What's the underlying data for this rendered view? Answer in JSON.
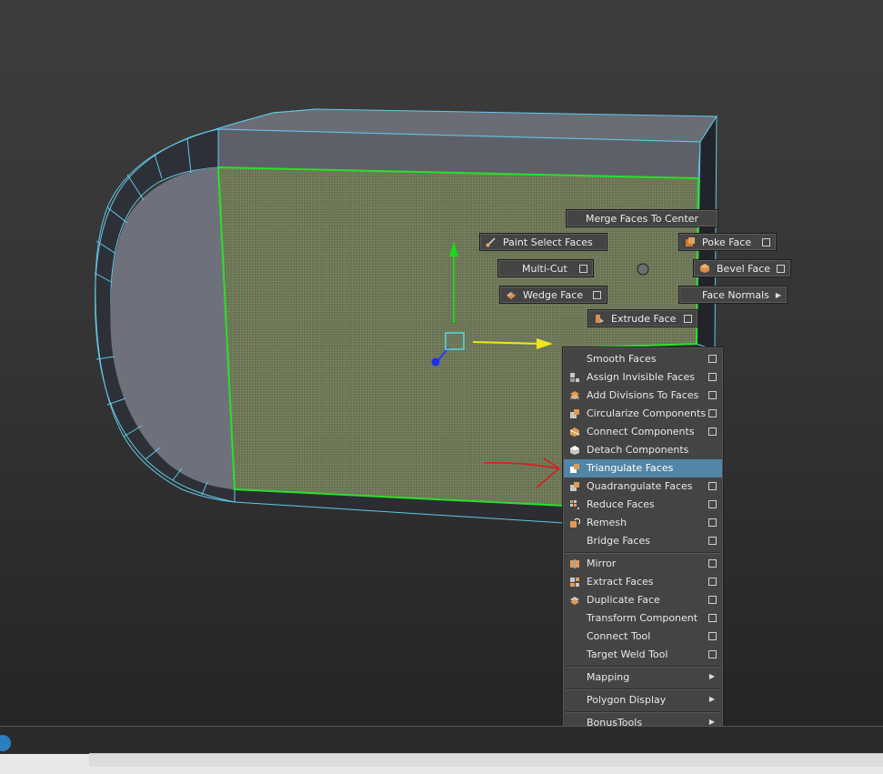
{
  "colors": {
    "wire": "#62c8e6",
    "selection": "#29e129",
    "face_fill": "#6b7556",
    "highlight": "#5285a6",
    "annotation": "#e01818"
  },
  "marking_menu": {
    "merge_faces_to_center": "Merge Faces To Center",
    "paint_select_faces": "Paint Select Faces",
    "poke_face": "Poke Face",
    "multi_cut": "Multi-Cut",
    "bevel_face": "Bevel Face",
    "wedge_face": "Wedge Face",
    "face_normals": "Face Normals",
    "extrude_face": "Extrude Face"
  },
  "menu": {
    "groups": [
      [
        {
          "label": "Smooth Faces",
          "icon": "none",
          "option": true
        },
        {
          "label": "Assign Invisible Faces",
          "icon": "invisible-faces-icon",
          "option": true
        },
        {
          "label": "Add Divisions To Faces",
          "icon": "add-divisions-icon",
          "option": true
        },
        {
          "label": "Circularize Components",
          "icon": "circularize-icon",
          "option": true
        },
        {
          "label": "Connect Components",
          "icon": "connect-components-icon",
          "option": true
        },
        {
          "label": "Detach Components",
          "icon": "detach-icon",
          "option": false
        },
        {
          "label": "Triangulate Faces",
          "icon": "triangulate-icon",
          "option": false,
          "highlighted": true
        },
        {
          "label": "Quadrangulate Faces",
          "icon": "quadrangulate-icon",
          "option": true
        },
        {
          "label": "Reduce Faces",
          "icon": "reduce-icon",
          "option": true
        },
        {
          "label": "Remesh",
          "icon": "remesh-icon",
          "option": true
        },
        {
          "label": "Bridge Faces",
          "icon": "none",
          "option": true
        }
      ],
      [
        {
          "label": "Mirror",
          "icon": "mirror-icon",
          "option": true
        },
        {
          "label": "Extract Faces",
          "icon": "extract-icon",
          "option": true
        },
        {
          "label": "Duplicate Face",
          "icon": "duplicate-icon",
          "option": true
        },
        {
          "label": "Transform Component",
          "icon": "none",
          "option": true
        },
        {
          "label": "Connect Tool",
          "icon": "none",
          "option": true
        },
        {
          "label": "Target Weld Tool",
          "icon": "none",
          "option": true
        }
      ],
      [
        {
          "label": "Mapping",
          "icon": "none",
          "submenu": true
        }
      ],
      [
        {
          "label": "Polygon Display",
          "icon": "none",
          "submenu": true
        }
      ],
      [
        {
          "label": "BonusTools",
          "icon": "none",
          "submenu": true
        }
      ]
    ]
  }
}
